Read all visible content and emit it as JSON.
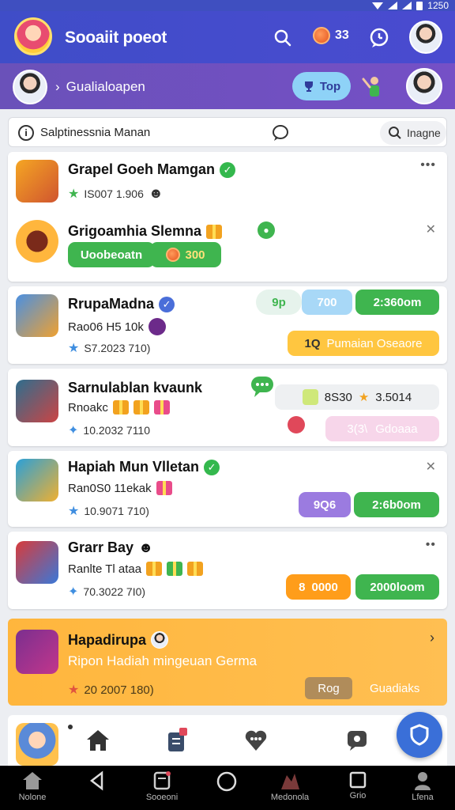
{
  "status_bar": {
    "time": "1250"
  },
  "app_bar": {
    "title": "Sooaiit poeot",
    "coin_count": "33"
  },
  "sub_bar": {
    "title": "Gualialoapen",
    "top_label": "Top"
  },
  "search_row": {
    "label": "Salptinessnia Manan",
    "insta_label": "Inagne"
  },
  "cards": [
    {
      "title": "Grapel Goeh Mamgan",
      "stat": "IS007 1.906"
    },
    {
      "title": "Grigoamhia Slemna",
      "green_label": "Uoobeoatn",
      "amount": "300"
    },
    {
      "title": "RrupaMadna",
      "sub": "Rao06 H5 10k",
      "stat": "S7.2023 710)",
      "pill_a": "9p",
      "pill_b": "700",
      "pill_c": "2:360om",
      "banner": "Pumaian Oseaore",
      "banner_prefix": "1Q"
    },
    {
      "title": "Sarnulablan kvaunk",
      "sub": "Rnoakc",
      "stat": "10.2032 7110",
      "score": "8S30",
      "score_b": "3.5014",
      "pink_label": "Gdoaaa",
      "pink_prefix": "3(3\\"
    },
    {
      "title": "Hapiah Mun Vlletan",
      "sub": "Ran0S0 11ekak",
      "stat": "10.9071 710)",
      "pill_a": "9Q6",
      "pill_b": "2:6b0om"
    },
    {
      "title": "Grarr Bay",
      "sub": "Ranlte Tl ataa",
      "stat": "70.3022 7I0)",
      "pill_a": "0000",
      "pill_a_prefix": "8",
      "pill_b": "2000loom"
    }
  ],
  "promo": {
    "title": "Hapadirupa",
    "subtitle": "Ripon Hadiah mingeuan Germa",
    "stat": "20 2007 180)",
    "button": "Rog",
    "link": "Guadiaks"
  },
  "system_nav": {
    "items": [
      "Nolone",
      "Sooeoni",
      "Medonola",
      "Grio",
      "Lfena"
    ]
  },
  "colors": {
    "app_bar": "#4a4bd0",
    "sub_bar": "#7550c6",
    "accent_green": "#3fb54f",
    "accent_orange": "#ff9d1a",
    "accent_purple": "#9b7be0",
    "fab": "#3a6fd8"
  }
}
